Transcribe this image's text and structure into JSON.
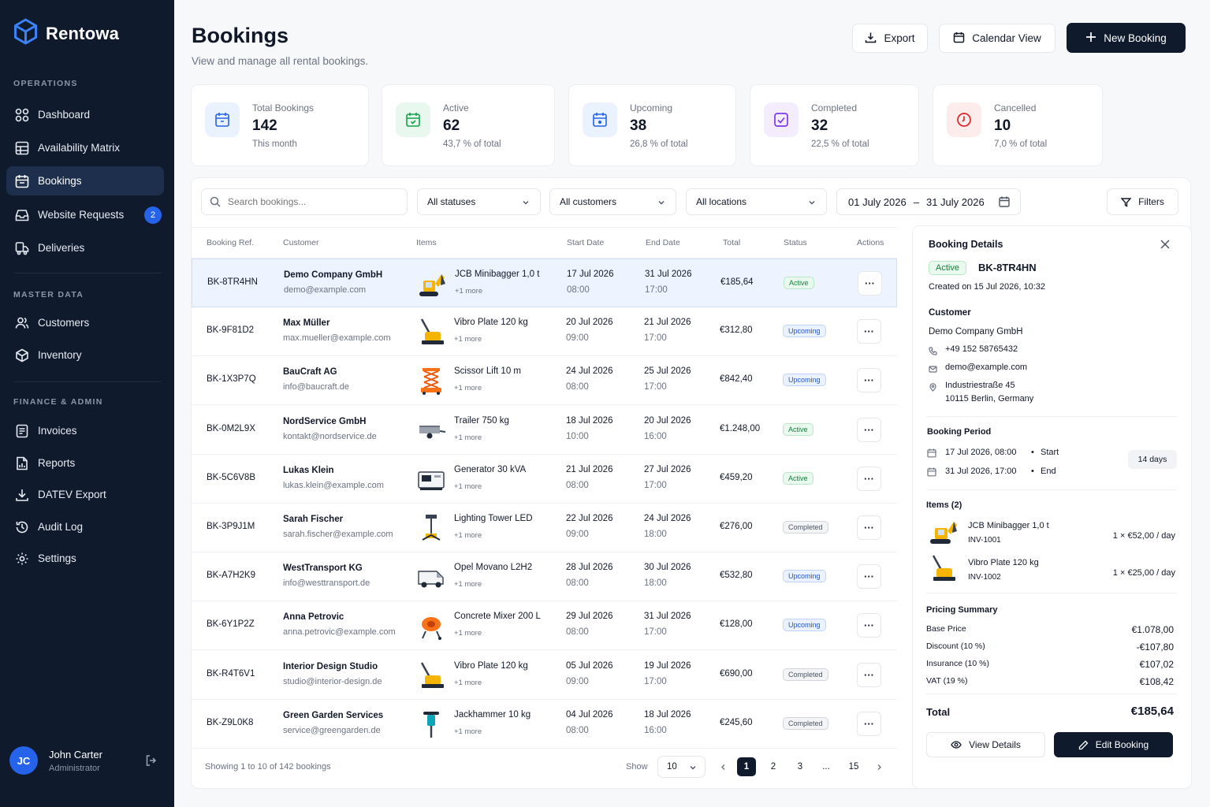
{
  "app": {
    "name": "Rentowa"
  },
  "sidebar": {
    "sections": [
      {
        "title": "OPERATIONS"
      },
      {
        "title": "MASTER DATA"
      },
      {
        "title": "FINANCE & ADMIN"
      }
    ],
    "items": [
      {
        "label": "Dashboard",
        "icon": "grid-icon"
      },
      {
        "label": "Availability Matrix",
        "icon": "table-icon"
      },
      {
        "label": "Bookings",
        "icon": "calendar-icon",
        "active": true
      },
      {
        "label": "Website Requests",
        "icon": "inbox-icon",
        "count": "2"
      },
      {
        "label": "Deliveries",
        "icon": "truck-icon"
      },
      {
        "label": "Customers",
        "icon": "users-icon"
      },
      {
        "label": "Inventory",
        "icon": "box-icon"
      },
      {
        "label": "Invoices",
        "icon": "invoice-icon"
      },
      {
        "label": "Reports",
        "icon": "report-icon"
      },
      {
        "label": "DATEV Export",
        "icon": "download-icon"
      },
      {
        "label": "Audit Log",
        "icon": "history-icon"
      },
      {
        "label": "Settings",
        "icon": "gear-icon"
      }
    ],
    "user": {
      "initials": "JC",
      "name": "John Carter",
      "role": "Administrator"
    }
  },
  "header": {
    "title": "Bookings",
    "subtitle": "View and manage all rental bookings.",
    "export_label": "Export",
    "calendar_label": "Calendar View",
    "new_label": "New Booking"
  },
  "stats": [
    {
      "label": "Total Bookings",
      "value": "142",
      "sub": "This month",
      "color": "#2563eb"
    },
    {
      "label": "Active",
      "value": "62",
      "sub": "43,7 % of total",
      "color": "#16a34a"
    },
    {
      "label": "Upcoming",
      "value": "38",
      "sub": "26,8 % of total",
      "color": "#2563eb"
    },
    {
      "label": "Completed",
      "value": "32",
      "sub": "22,5 % of total",
      "color": "#7c3aed"
    },
    {
      "label": "Cancelled",
      "value": "10",
      "sub": "7,0 % of total",
      "color": "#dc2626"
    }
  ],
  "filters": {
    "search_placeholder": "Search bookings...",
    "status": "All statuses",
    "customers": "All customers",
    "locations": "All locations",
    "date_from": "01 July 2026",
    "date_sep": "–",
    "date_to": "31 July 2026",
    "filters_label": "Filters"
  },
  "table": {
    "columns": [
      "Booking Ref.",
      "Customer",
      "Items",
      "Start Date",
      "End Date",
      "Total",
      "Status",
      "Actions"
    ],
    "rows": [
      {
        "ref": "BK-8TR4HN",
        "customer": "Demo Company GmbH",
        "email": "demo@example.com",
        "item": "JCB Minibagger 1,0 t",
        "more": "+1 more",
        "thumb": "excavator",
        "start_date": "17 Jul 2026",
        "start_time": "08:00",
        "end_date": "31 Jul 2026",
        "end_time": "17:00",
        "total": "€185,64",
        "status": "Active"
      },
      {
        "ref": "BK-9F81D2",
        "customer": "Max Müller",
        "email": "max.mueller@example.com",
        "item": "Vibro Plate 120 kg",
        "more": "+1 more",
        "thumb": "plate",
        "start_date": "20 Jul 2026",
        "start_time": "09:00",
        "end_date": "21 Jul 2026",
        "end_time": "17:00",
        "total": "€312,80",
        "status": "Upcoming"
      },
      {
        "ref": "BK-1X3P7Q",
        "customer": "BauCraft AG",
        "email": "info@baucraft.de",
        "item": "Scissor Lift 10 m",
        "more": "+1 more",
        "thumb": "lift",
        "start_date": "24 Jul 2026",
        "start_time": "08:00",
        "end_date": "25 Jul 2026",
        "end_time": "17:00",
        "total": "€842,40",
        "status": "Upcoming"
      },
      {
        "ref": "BK-0M2L9X",
        "customer": "NordService GmbH",
        "email": "kontakt@nordservice.de",
        "item": "Trailer 750 kg",
        "more": "+1 more",
        "thumb": "trailer",
        "start_date": "18 Jul 2026",
        "start_time": "10:00",
        "end_date": "20 Jul 2026",
        "end_time": "16:00",
        "total": "€1.248,00",
        "status": "Active"
      },
      {
        "ref": "BK-5C6V8B",
        "customer": "Lukas Klein",
        "email": "lukas.klein@example.com",
        "item": "Generator 30 kVA",
        "more": "+1 more",
        "thumb": "generator",
        "start_date": "21 Jul 2026",
        "start_time": "08:00",
        "end_date": "27 Jul 2026",
        "end_time": "17:00",
        "total": "€459,20",
        "status": "Active"
      },
      {
        "ref": "BK-3P9J1M",
        "customer": "Sarah Fischer",
        "email": "sarah.fischer@example.com",
        "item": "Lighting Tower LED",
        "more": "+1 more",
        "thumb": "tower",
        "start_date": "22 Jul 2026",
        "start_time": "09:00",
        "end_date": "24 Jul 2026",
        "end_time": "18:00",
        "total": "€276,00",
        "status": "Completed"
      },
      {
        "ref": "BK-A7H2K9",
        "customer": "WestTransport KG",
        "email": "info@westtransport.de",
        "item": "Opel Movano L2H2",
        "more": "+1 more",
        "thumb": "van",
        "start_date": "28 Jul 2026",
        "start_time": "08:00",
        "end_date": "30 Jul 2026",
        "end_time": "18:00",
        "total": "€532,80",
        "status": "Upcoming"
      },
      {
        "ref": "BK-6Y1P2Z",
        "customer": "Anna Petrovic",
        "email": "anna.petrovic@example.com",
        "item": "Concrete Mixer 200 L",
        "more": "+1 more",
        "thumb": "mixer",
        "start_date": "29 Jul 2026",
        "start_time": "08:00",
        "end_date": "31 Jul 2026",
        "end_time": "17:00",
        "total": "€128,00",
        "status": "Upcoming"
      },
      {
        "ref": "BK-R4T6V1",
        "customer": "Interior Design Studio",
        "email": "studio@interior-design.de",
        "item": "Vibro Plate 120 kg",
        "more": "+1 more",
        "thumb": "plate",
        "start_date": "05 Jul 2026",
        "start_time": "09:00",
        "end_date": "19 Jul 2026",
        "end_time": "17:00",
        "total": "€690,00",
        "status": "Completed"
      },
      {
        "ref": "BK-Z9L0K8",
        "customer": "Green Garden Services",
        "email": "service@greengarden.de",
        "item": "Jackhammer 10 kg",
        "more": "+1 more",
        "thumb": "hammer",
        "start_date": "04 Jul 2026",
        "start_time": "08:00",
        "end_date": "18 Jul 2026",
        "end_time": "16:00",
        "total": "€245,60",
        "status": "Completed"
      }
    ],
    "footer": {
      "showing": "Showing 1 to 10 of 142 bookings",
      "show_label": "Show",
      "per_page": "10",
      "pages": [
        "1",
        "2",
        "3",
        "...",
        "15"
      ],
      "current_page": "1"
    }
  },
  "details": {
    "title": "Booking Details",
    "status": "Active",
    "ref": "BK-8TR4HN",
    "created": "Created on 15 Jul 2026, 10:32",
    "customer_title": "Customer",
    "customer_name": "Demo Company GmbH",
    "phone": "+49 152 58765432",
    "email": "demo@example.com",
    "address1": "Industriestraße 45",
    "address2": "10115 Berlin, Germany",
    "period_title": "Booking Period",
    "start": "17 Jul 2026, 08:00",
    "start_label": "Start",
    "end": "31 Jul 2026, 17:00",
    "end_label": "End",
    "days": "14 days",
    "items_title": "Items (2)",
    "items": [
      {
        "name": "JCB Minibagger 1,0 t",
        "inv": "INV-1001",
        "price": "1 × €52,00 / day"
      },
      {
        "name": "Vibro Plate 120 kg",
        "inv": "INV-1002",
        "price": "1 × €25,00 / day"
      }
    ],
    "pricing_title": "Pricing Summary",
    "pricing": [
      {
        "label": "Base Price",
        "value": "€1.078,00"
      },
      {
        "label": "Discount (10 %)",
        "value": "-€107,80"
      },
      {
        "label": "Insurance (10 %)",
        "value": "€107,02"
      },
      {
        "label": "VAT (19 %)",
        "value": "€108,42"
      }
    ],
    "total_label": "Total",
    "total": "€185,64",
    "view_label": "View Details",
    "edit_label": "Edit Booking"
  }
}
